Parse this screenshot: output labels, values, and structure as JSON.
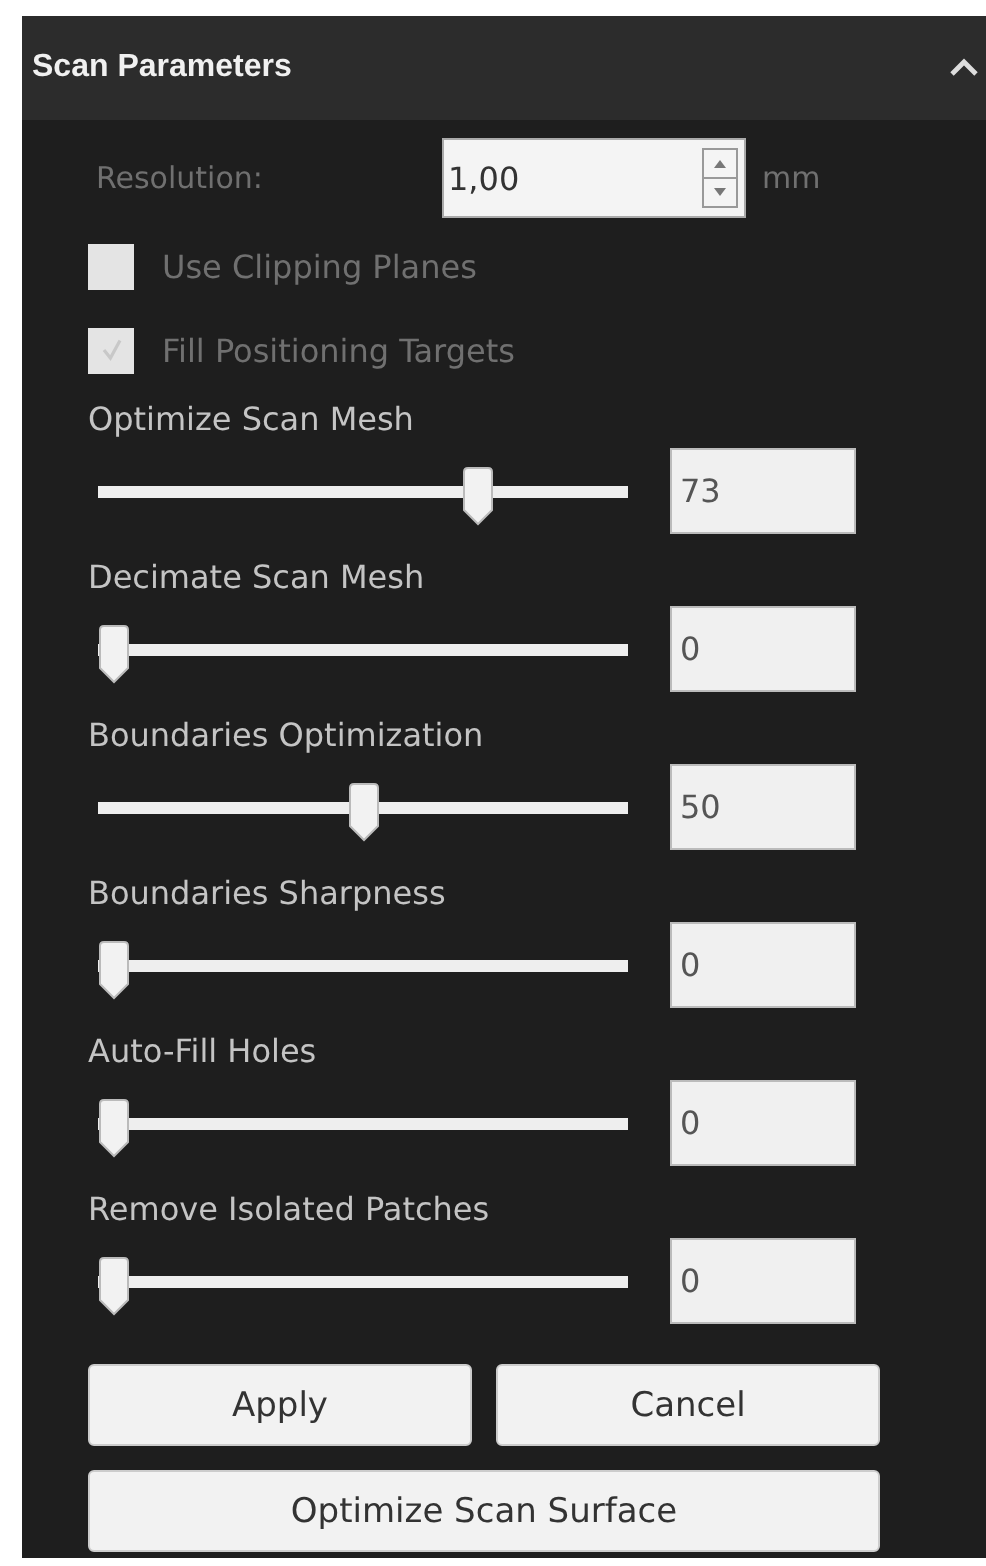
{
  "panel": {
    "title": "Scan Parameters",
    "expanded": true
  },
  "resolution": {
    "label": "Resolution:",
    "value": "1,00",
    "unit": "mm",
    "disabled": true
  },
  "checkboxes": [
    {
      "label": "Use Clipping Planes",
      "checked": false,
      "disabled": true
    },
    {
      "label": "Fill Positioning Targets",
      "checked": true,
      "disabled": true
    }
  ],
  "sliders": [
    {
      "label": "Optimize Scan Mesh",
      "level": 0.73,
      "value": "73"
    },
    {
      "label": "Decimate Scan Mesh",
      "level": 0,
      "value": "0"
    },
    {
      "label": "Boundaries Optimization",
      "level": 0.5,
      "value": "50"
    },
    {
      "label": "Boundaries Sharpness",
      "level": 0,
      "value": "0"
    },
    {
      "label": "Auto-Fill Holes",
      "level": 0,
      "value": "0"
    },
    {
      "label": "Remove Isolated Patches",
      "level": 0,
      "value": "0"
    }
  ],
  "buttons": [
    {
      "label": "Apply",
      "kind": "half"
    },
    {
      "label": "Cancel",
      "kind": "half"
    },
    {
      "label": "Optimize Scan Surface",
      "kind": "wide"
    }
  ]
}
